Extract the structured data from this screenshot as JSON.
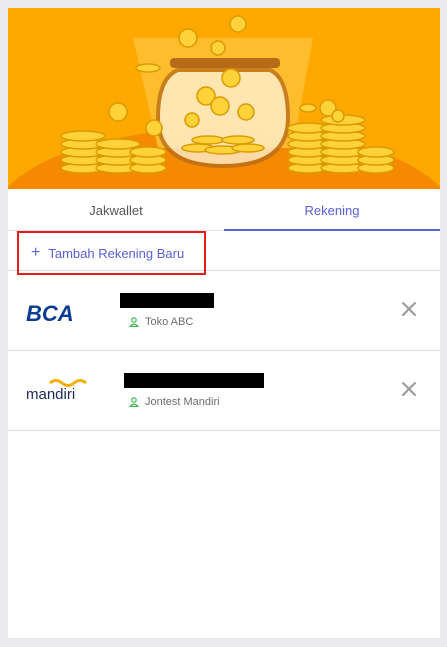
{
  "tabs": [
    {
      "label": "Jakwallet"
    },
    {
      "label": "Rekening"
    }
  ],
  "active_tab": "Rekening",
  "add_account": {
    "icon": "plus-icon",
    "label": "Tambah Rekening Baru"
  },
  "accounts": [
    {
      "bank": "BCA",
      "logo_text": "BCA",
      "number": "",
      "name": "Toko ABC",
      "person_icon": "user-icon",
      "remove_icon": "close-icon"
    },
    {
      "bank": "Mandiri",
      "logo_text": "mandiri",
      "number": "",
      "name": "Jontest Mandiri",
      "person_icon": "user-icon",
      "remove_icon": "close-icon"
    }
  ],
  "colors": {
    "accent": "#5a60d6",
    "hero_bg": "#ffa800",
    "highlight_border": "#e31b1b",
    "bca_blue": "#0a3d91",
    "mandiri_yellow": "#f2b100",
    "person_green": "#3bb54a"
  }
}
